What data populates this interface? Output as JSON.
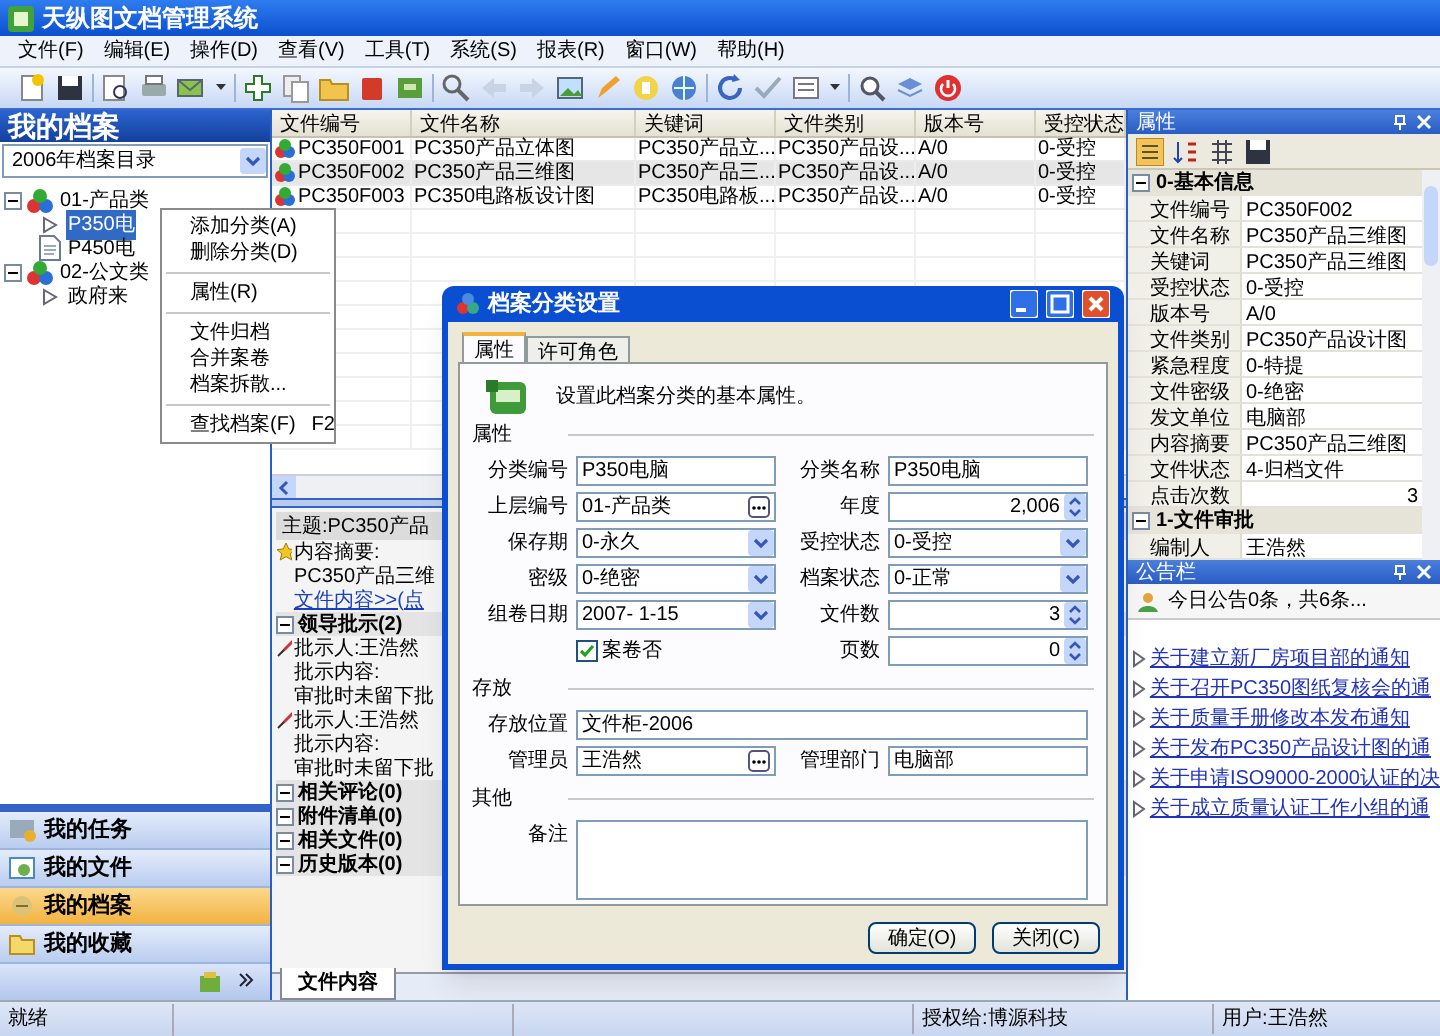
{
  "window": {
    "title": "天纵图文档管理系统"
  },
  "menu": [
    "文件(F)",
    "编辑(E)",
    "操作(D)",
    "查看(V)",
    "工具(T)",
    "系统(S)",
    "报表(R)",
    "窗口(W)",
    "帮助(H)"
  ],
  "sidebar": {
    "title": "我的档案",
    "catalog": "2006年档案目录",
    "tree": [
      {
        "label": "01-产品类",
        "expanded": true,
        "selected": false,
        "children": [
          {
            "label": "P350电",
            "selected": true
          },
          {
            "label": "P450电",
            "selected": false
          }
        ]
      },
      {
        "label": "02-公文类",
        "expanded": true,
        "selected": false,
        "children": [
          {
            "label": "政府来",
            "selected": false
          }
        ]
      }
    ],
    "nav": [
      {
        "label": "我的任务",
        "selected": false
      },
      {
        "label": "我的文件",
        "selected": false
      },
      {
        "label": "我的档案",
        "selected": true
      },
      {
        "label": "我的收藏",
        "selected": false
      }
    ]
  },
  "context_menu": {
    "groups": [
      [
        {
          "label": "添加分类(A)"
        },
        {
          "label": "删除分类(D)"
        }
      ],
      [
        {
          "label": "属性(R)"
        }
      ],
      [
        {
          "label": "文件归档"
        },
        {
          "label": "合并案卷"
        },
        {
          "label": "档案拆散..."
        }
      ],
      [
        {
          "label": "查找档案(F)",
          "shortcut": "F2"
        }
      ]
    ]
  },
  "table": {
    "columns": [
      "文件编号",
      "文件名称",
      "关键词",
      "文件类别",
      "版本号",
      "受控状态"
    ],
    "rows": [
      {
        "selected": false,
        "cells": [
          "PC350F001",
          "PC350产品立体图",
          "PC350产品立...",
          "PC350产品设...",
          "A/0",
          "0-受控"
        ]
      },
      {
        "selected": true,
        "cells": [
          "PC350F002",
          "PC350产品三维图",
          "PC350产品三...",
          "PC350产品设...",
          "A/0",
          "0-受控"
        ]
      },
      {
        "selected": false,
        "cells": [
          "PC350F003",
          "PC350电路板设计图",
          "PC350电路板...",
          "PC350产品设...",
          "A/0",
          "0-受控"
        ]
      }
    ]
  },
  "detail": {
    "subject": "主题:PC350产品",
    "summary_label": "内容摘要:",
    "summary": "PC350产品三维",
    "content_link": "文件内容>>(点",
    "sections": [
      {
        "label": "领导批示(2)",
        "expanded": true,
        "entries": [
          {
            "approver": "批示人:王浩然",
            "content_label": "批示内容:",
            "content": "审批时未留下批"
          },
          {
            "approver": "批示人:王浩然",
            "content_label": "批示内容:",
            "content": "审批时未留下批"
          }
        ]
      },
      {
        "label": "相关评论(0)",
        "expanded": true
      },
      {
        "label": "附件清单(0)",
        "expanded": true
      },
      {
        "label": "相关文件(0)",
        "expanded": true
      },
      {
        "label": "历史版本(0)",
        "expanded": true
      }
    ],
    "tabs": [
      {
        "label": "文件内容",
        "selected": true
      }
    ]
  },
  "dialog": {
    "title": "档案分类设置",
    "tabs": [
      {
        "label": "属性",
        "selected": true
      },
      {
        "label": "许可角色",
        "selected": false
      }
    ],
    "intro": "设置此档案分类的基本属性。",
    "sections": [
      {
        "label": "属性",
        "fields": [
          {
            "label": "分类编号",
            "value": "P350电脑",
            "kind": "text"
          },
          {
            "label": "分类名称",
            "value": "P350电脑",
            "kind": "text"
          },
          {
            "label": "上层编号",
            "value": "01-产品类",
            "kind": "picker"
          },
          {
            "label": "年度",
            "value": "2,006",
            "kind": "spin"
          },
          {
            "label": "保存期",
            "value": "0-永久",
            "kind": "select"
          },
          {
            "label": "受控状态",
            "value": "0-受控",
            "kind": "select"
          },
          {
            "label": "密级",
            "value": "0-绝密",
            "kind": "select"
          },
          {
            "label": "档案状态",
            "value": "0-正常",
            "kind": "select"
          },
          {
            "label": "组卷日期",
            "value": "2007- 1-15",
            "kind": "select"
          },
          {
            "label": "文件数",
            "value": "3",
            "kind": "spin"
          },
          {
            "label": "案卷否",
            "checked": true,
            "kind": "checkbox"
          },
          {
            "label": "页数",
            "value": "0",
            "kind": "spin"
          }
        ]
      },
      {
        "label": "存放",
        "fields": [
          {
            "label": "存放位置",
            "value": "文件柜-2006",
            "kind": "text"
          },
          {
            "label": "管理员",
            "value": "王浩然",
            "kind": "picker"
          },
          {
            "label": "管理部门",
            "value": "电脑部",
            "kind": "text"
          }
        ]
      },
      {
        "label": "其他",
        "fields": [
          {
            "label": "备注",
            "kind": "textarea"
          }
        ]
      }
    ],
    "buttons": [
      "确定(O)",
      "关闭(C)"
    ]
  },
  "properties": {
    "title": "属性",
    "groups": [
      {
        "label": "0-基本信息",
        "expanded": true,
        "rows": [
          {
            "key": "文件编号",
            "value": "PC350F002"
          },
          {
            "key": "文件名称",
            "value": "PC350产品三维图"
          },
          {
            "key": "关键词",
            "value": "PC350产品三维图"
          },
          {
            "key": "受控状态",
            "value": "0-受控"
          },
          {
            "key": "版本号",
            "value": "A/0"
          },
          {
            "key": "文件类别",
            "value": "PC350产品设计图"
          },
          {
            "key": "紧急程度",
            "value": "0-特提"
          },
          {
            "key": "文件密级",
            "value": "0-绝密"
          },
          {
            "key": "发文单位",
            "value": "电脑部"
          },
          {
            "key": "内容摘要",
            "value": "PC350产品三维图"
          },
          {
            "key": "文件状态",
            "value": "4-归档文件"
          },
          {
            "key": "点击次数",
            "value": "3",
            "kind": "number"
          }
        ]
      },
      {
        "label": "1-文件审批",
        "expanded": true,
        "rows": [
          {
            "key": "编制人",
            "value": "王浩然"
          }
        ]
      }
    ]
  },
  "notices": {
    "title": "公告栏",
    "summary": "今日公告0条，共6条...",
    "items": [
      "关于建立新厂房项目部的通知",
      "关于召开PC350图纸复核会的通",
      "关于质量手册修改本发布通知",
      "关于发布PC350产品设计图的通",
      "关于申请ISO9000-2000认证的决",
      "关于成立质量认证工作小组的通"
    ]
  },
  "status_bar": {
    "state": "就绪",
    "license": "授权给:博源科技",
    "user": "用户:王浩然"
  }
}
